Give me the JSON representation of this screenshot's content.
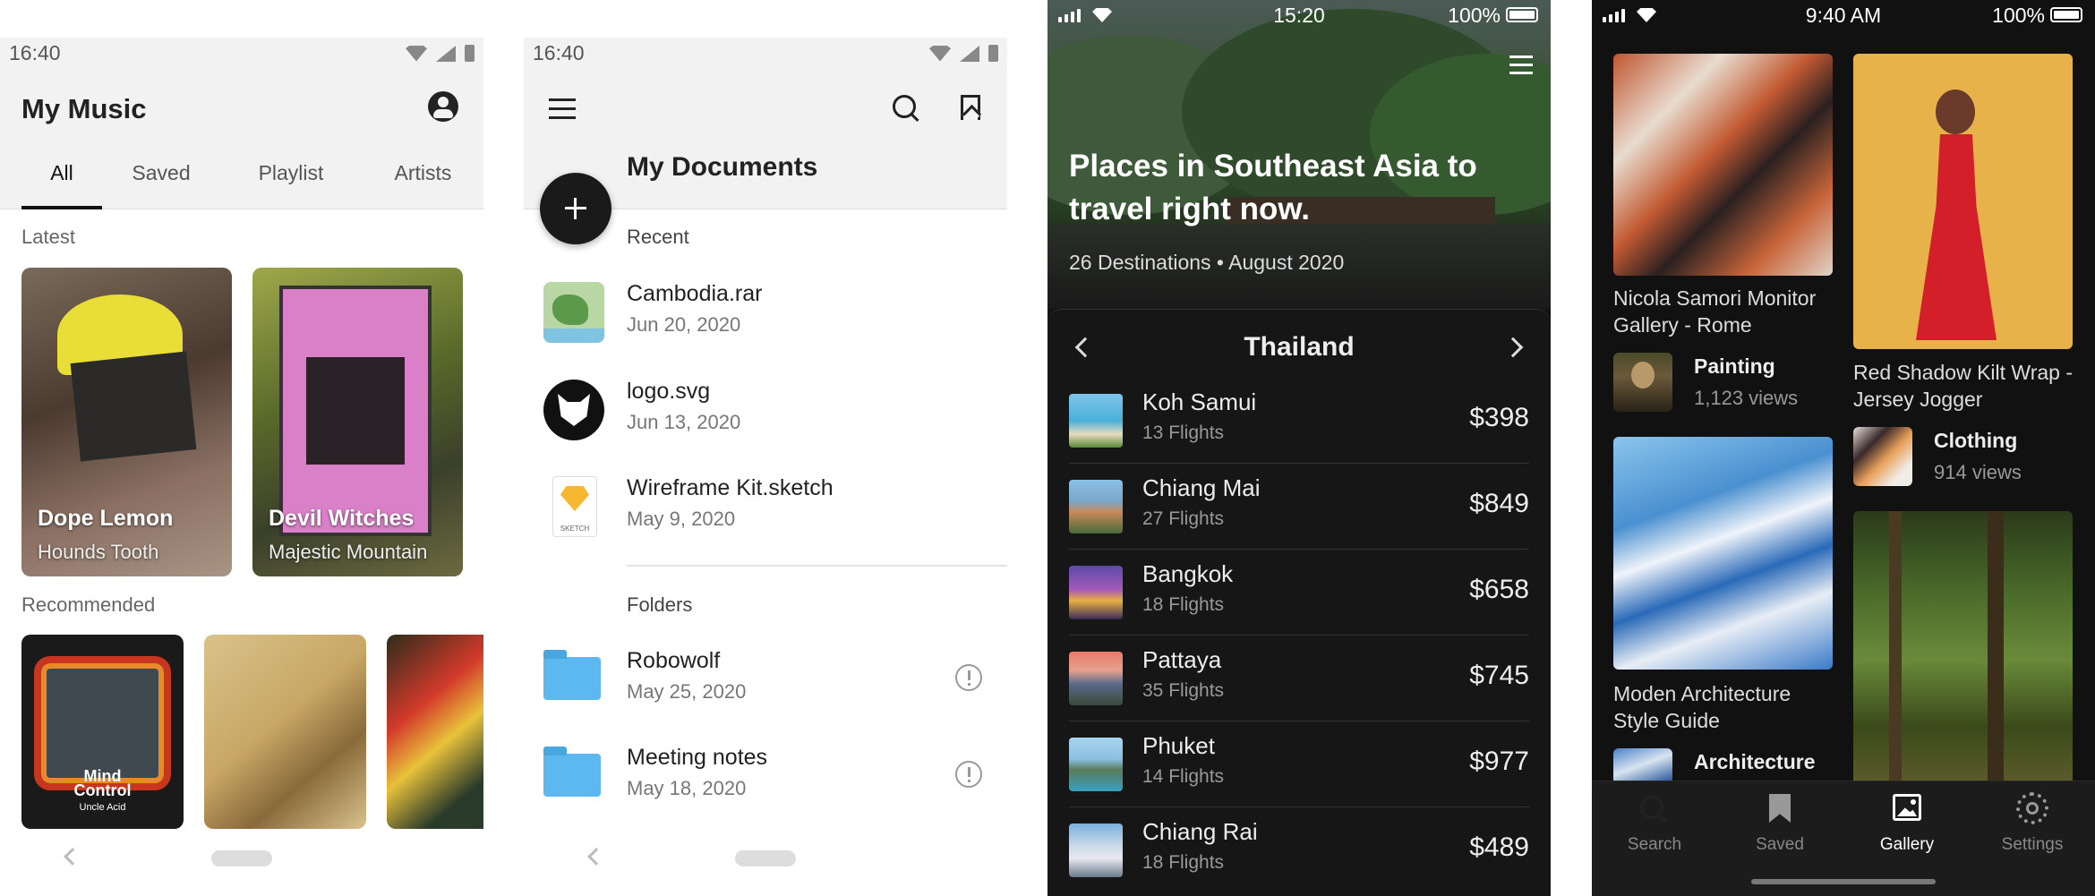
{
  "music": {
    "status_time": "16:40",
    "title": "My Music",
    "tabs": [
      {
        "label": "All"
      },
      {
        "label": "Saved"
      },
      {
        "label": "Playlist"
      },
      {
        "label": "Artists"
      }
    ],
    "latest_label": "Latest",
    "latest": [
      {
        "title": "Dope Lemon",
        "artist": "Hounds Tooth"
      },
      {
        "title": "Devil Witches",
        "artist": "Majestic Mountain"
      }
    ],
    "recommended_label": "Recommended",
    "recommended_album_text": {
      "line1": "Mind",
      "line2": "Control",
      "line3": "Uncle Acid"
    }
  },
  "documents": {
    "status_time": "16:40",
    "title": "My Documents",
    "recent_label": "Recent",
    "recent": [
      {
        "name": "Cambodia.rar",
        "date": "Jun 20, 2020"
      },
      {
        "name": "logo.svg",
        "date": "Jun 13, 2020"
      },
      {
        "name": "Wireframe Kit.sketch",
        "date": "May 9, 2020",
        "thumb_label": "SKETCH"
      }
    ],
    "folders_label": "Folders",
    "folders": [
      {
        "name": "Robowolf",
        "date": "May 25, 2020"
      },
      {
        "name": "Meeting notes",
        "date": "May 18, 2020"
      }
    ]
  },
  "travel": {
    "status_time": "15:20",
    "battery": "100%",
    "title": "Places in Southeast Asia to travel right now.",
    "subtitle": "26 Destinations • August 2020",
    "country": "Thailand",
    "destinations": [
      {
        "name": "Koh Samui",
        "flights": "13 Flights",
        "price": "$398"
      },
      {
        "name": "Chiang Mai",
        "flights": "27 Flights",
        "price": "$849"
      },
      {
        "name": "Bangkok",
        "flights": "18 Flights",
        "price": "$658"
      },
      {
        "name": "Pattaya",
        "flights": "35 Flights",
        "price": "$745"
      },
      {
        "name": "Phuket",
        "flights": "14 Flights",
        "price": "$977"
      },
      {
        "name": "Chiang Rai",
        "flights": "18 Flights",
        "price": "$489"
      }
    ]
  },
  "gallery": {
    "status_time": "9:40 AM",
    "battery": "100%",
    "items": [
      {
        "caption": "Nicola Samori Monitor Gallery - Rome",
        "category": "Painting",
        "views": "1,123 views"
      },
      {
        "caption": "Red Shadow Kilt Wrap - Jersey Jogger",
        "category": "Clothing",
        "views": "914 views"
      },
      {
        "caption": "Moden Architecture Style Guide",
        "category": "Architecture"
      }
    ],
    "tabs": [
      {
        "label": "Search",
        "icon": "search-icon"
      },
      {
        "label": "Saved",
        "icon": "bookmark-icon"
      },
      {
        "label": "Gallery",
        "icon": "image-icon"
      },
      {
        "label": "Settings",
        "icon": "gear-icon"
      }
    ]
  }
}
